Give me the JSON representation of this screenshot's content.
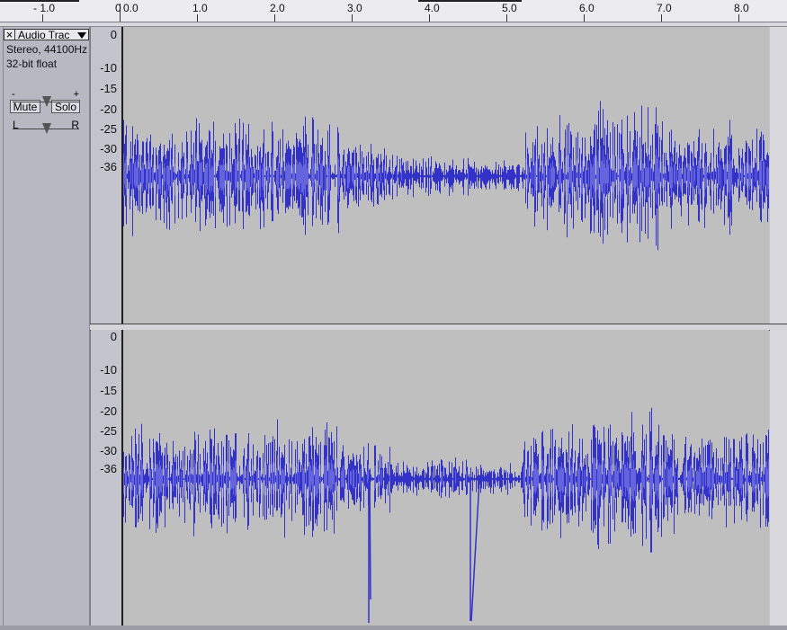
{
  "ruler": {
    "labels": [
      "- 1.0",
      "0",
      "0.0",
      "1.0",
      "2.0",
      "3.0",
      "4.0",
      "5.0",
      "6.0",
      "7.0",
      "8.0"
    ]
  },
  "track": {
    "name": "Audio Trac",
    "format": "Stereo, 44100Hz",
    "bit_depth": "32-bit float",
    "mute_label": "Mute",
    "solo_label": "Solo",
    "gain_minus": "-",
    "gain_plus": "+",
    "pan_left": "L",
    "pan_right": "R",
    "close_icon": "×"
  },
  "scale": {
    "labels": [
      "0",
      "-10",
      "-15",
      "-20",
      "-25",
      "-30",
      "-36"
    ]
  },
  "colors": {
    "waveform": "#3232c8",
    "waveform_rms": "#6464dc",
    "background": "#bfbfbf"
  }
}
